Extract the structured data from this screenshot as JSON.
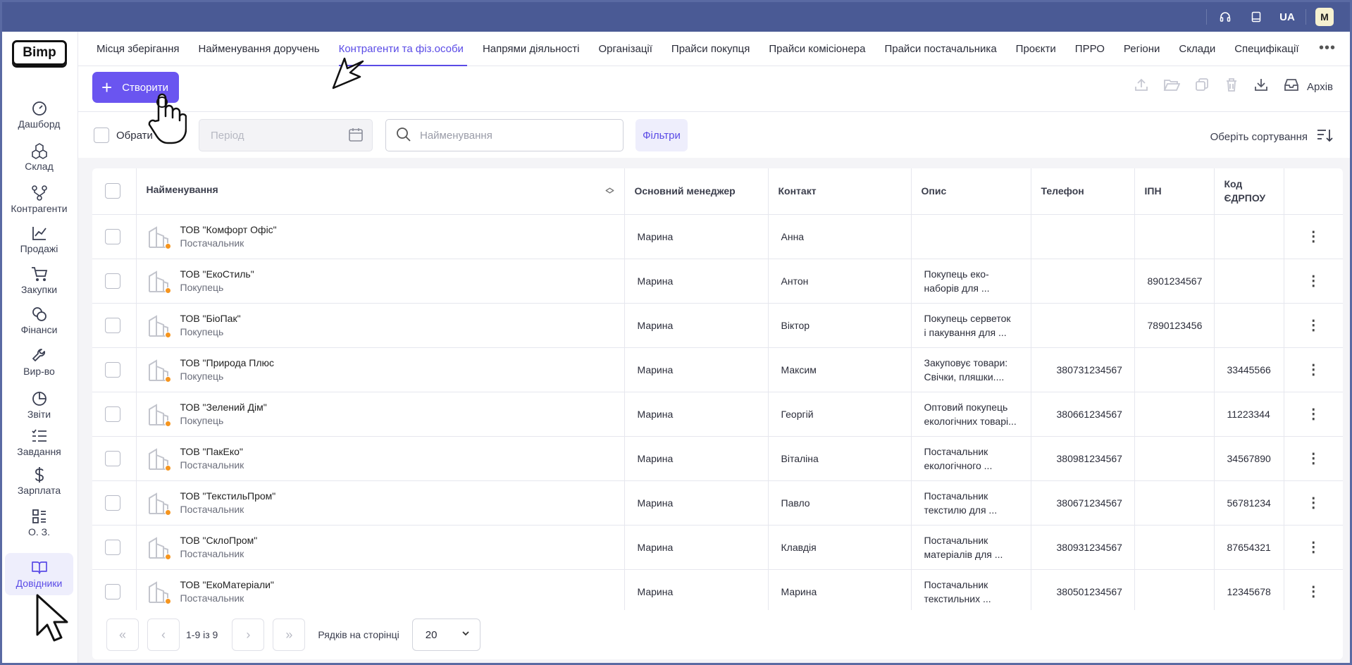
{
  "topbar": {
    "language": "UA",
    "user_initial": "M",
    "icons": [
      "headset-icon",
      "book-icon"
    ]
  },
  "logo": "Bimp",
  "sidebar": {
    "items": [
      {
        "label": "Дашборд",
        "icon": "gauge-icon",
        "glyph": "◔"
      },
      {
        "label": "Склад",
        "icon": "boxes-icon",
        "glyph": "⬡"
      },
      {
        "label": "Контрагенти",
        "icon": "network-icon",
        "glyph": "⑂"
      },
      {
        "label": "Продажі",
        "icon": "line-chart-icon",
        "glyph": "📈"
      },
      {
        "label": "Закупки",
        "icon": "cart-icon",
        "glyph": "🛒"
      },
      {
        "label": "Фінанси",
        "icon": "coins-icon",
        "glyph": "◎"
      },
      {
        "label": "Вир-во",
        "icon": "wrench-icon",
        "glyph": "🔧"
      },
      {
        "label": "Звіти",
        "icon": "pie-chart-icon",
        "glyph": "◕"
      },
      {
        "label": "Завдання",
        "icon": "checklist-icon",
        "glyph": "☷"
      },
      {
        "label": "Зарплата",
        "icon": "dollar-icon",
        "glyph": "$"
      },
      {
        "label": "О. З.",
        "icon": "grid-icon",
        "glyph": "▦"
      },
      {
        "label": "Довідники",
        "icon": "open-book-icon",
        "glyph": "📖"
      }
    ]
  },
  "tabs": [
    "Місця зберігання",
    "Найменування доручень",
    "Контрагенти та фіз.особи",
    "Напрями діяльності",
    "Організації",
    "Прайси покупця",
    "Прайси комісіонера",
    "Прайси постачальника",
    "Проєкти",
    "ПРРО",
    "Регіони",
    "Склади",
    "Специфікації"
  ],
  "active_tab": "Контрагенти та фіз.особи",
  "toolbar": {
    "create_label": "Створити",
    "archive_label": "Архів"
  },
  "filters": {
    "select_all_label": "Обрати",
    "period_placeholder": "Період",
    "search_placeholder": "Найменування",
    "filters_label": "Фільтри",
    "sort_label": "Оберіть сортування"
  },
  "table": {
    "headers": {
      "name": "Найменування",
      "manager": "Основний менеджер",
      "contact": "Контакт",
      "description": "Опис",
      "phone": "Телефон",
      "ipn": "ІПН",
      "code_line1": "Код",
      "code_line2": "ЄДРПОУ"
    },
    "rows": [
      {
        "name": "ТОВ \"Комфорт Офіс\"",
        "type": "Постачальник",
        "manager": "Марина",
        "contact": "Анна",
        "desc1": "",
        "desc2": "",
        "phone": "",
        "ipn": "",
        "code": ""
      },
      {
        "name": "ТОВ \"ЕкоСтиль\"",
        "type": "Покупець",
        "manager": "Марина",
        "contact": "Антон",
        "desc1": "Покупець еко-",
        "desc2": "наборів для ...",
        "phone": "",
        "ipn": "8901234567",
        "code": ""
      },
      {
        "name": "ТОВ \"БіоПак\"",
        "type": "Покупець",
        "manager": "Марина",
        "contact": "Віктор",
        "desc1": " Покупець серветок",
        "desc2": "і пакування для ...",
        "phone": "",
        "ipn": "7890123456",
        "code": ""
      },
      {
        "name": "ТОВ \"Природа Плюс",
        "type": "Покупець",
        "manager": "Марина",
        "contact": "Максим",
        "desc1": "Закуповує товари:",
        "desc2": "Свічки, пляшки....",
        "phone": "380731234567",
        "ipn": "",
        "code": "33445566"
      },
      {
        "name": "ТОВ \"Зелений Дім\"",
        "type": "Покупець",
        "manager": "Марина",
        "contact": "Георгій",
        "desc1": "Оптовий покупець",
        "desc2": "екологічних товарі...",
        "phone": "380661234567",
        "ipn": "",
        "code": "11223344"
      },
      {
        "name": "ТОВ \"ПакЕко\"",
        "type": "Постачальник",
        "manager": "Марина",
        "contact": "Віталіна",
        "desc1": " Постачальник",
        "desc2": "екологічного ...",
        "phone": "380981234567",
        "ipn": "",
        "code": "34567890"
      },
      {
        "name": "ТОВ \"ТекстильПром\"",
        "type": "Постачальник",
        "manager": "Марина",
        "contact": "Павло",
        "desc1": "Постачальник",
        "desc2": "текстилю для ...",
        "phone": "380671234567",
        "ipn": "",
        "code": "56781234"
      },
      {
        "name": "ТОВ \"СклоПром\"",
        "type": "Постачальник",
        "manager": "Марина",
        "contact": "Клавдія",
        "desc1": "Постачальник",
        "desc2": "матеріалів для ...",
        "phone": "380931234567",
        "ipn": "",
        "code": "87654321"
      },
      {
        "name": "ТОВ \"ЕкоМатеріали\"",
        "type": "Постачальник",
        "manager": "Марина",
        "contact": "Марина",
        "desc1": " Постачальник",
        "desc2": "текстильних ...",
        "phone": "380501234567",
        "ipn": "",
        "code": "12345678"
      }
    ]
  },
  "pagination": {
    "range": "1-9 із 9",
    "rows_label": "Рядків на сторінці",
    "rows_value": "20"
  },
  "colors": {
    "accent": "#6a55f0",
    "topbar": "#4a5a95",
    "status_dot": "#f5951f"
  }
}
